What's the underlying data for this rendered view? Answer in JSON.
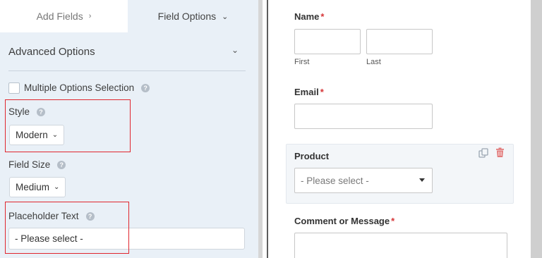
{
  "tabs": {
    "add_fields": "Add Fields",
    "field_options": "Field Options"
  },
  "icons": {
    "chevron_right": "›",
    "chevron_down": "⌄",
    "caret_down": "⌄",
    "help": "?"
  },
  "advanced": {
    "title": "Advanced Options",
    "multiple_selection_label": "Multiple Options Selection",
    "multiple_selection_checked": false,
    "style_label": "Style",
    "style_value": "Modern",
    "field_size_label": "Field Size",
    "field_size_value": "Medium",
    "placeholder_label": "Placeholder Text",
    "placeholder_value": "- Please select -"
  },
  "form": {
    "name_label": "Name",
    "required_mark": "*",
    "first_sublabel": "First",
    "last_sublabel": "Last",
    "email_label": "Email",
    "product_label": "Product",
    "product_placeholder": "- Please select -",
    "comment_label": "Comment or Message"
  },
  "colors": {
    "highlight": "#e0262e",
    "required": "#d63638",
    "panel_bg": "#e9f0f7",
    "delete_icon": "#e27b7b"
  }
}
